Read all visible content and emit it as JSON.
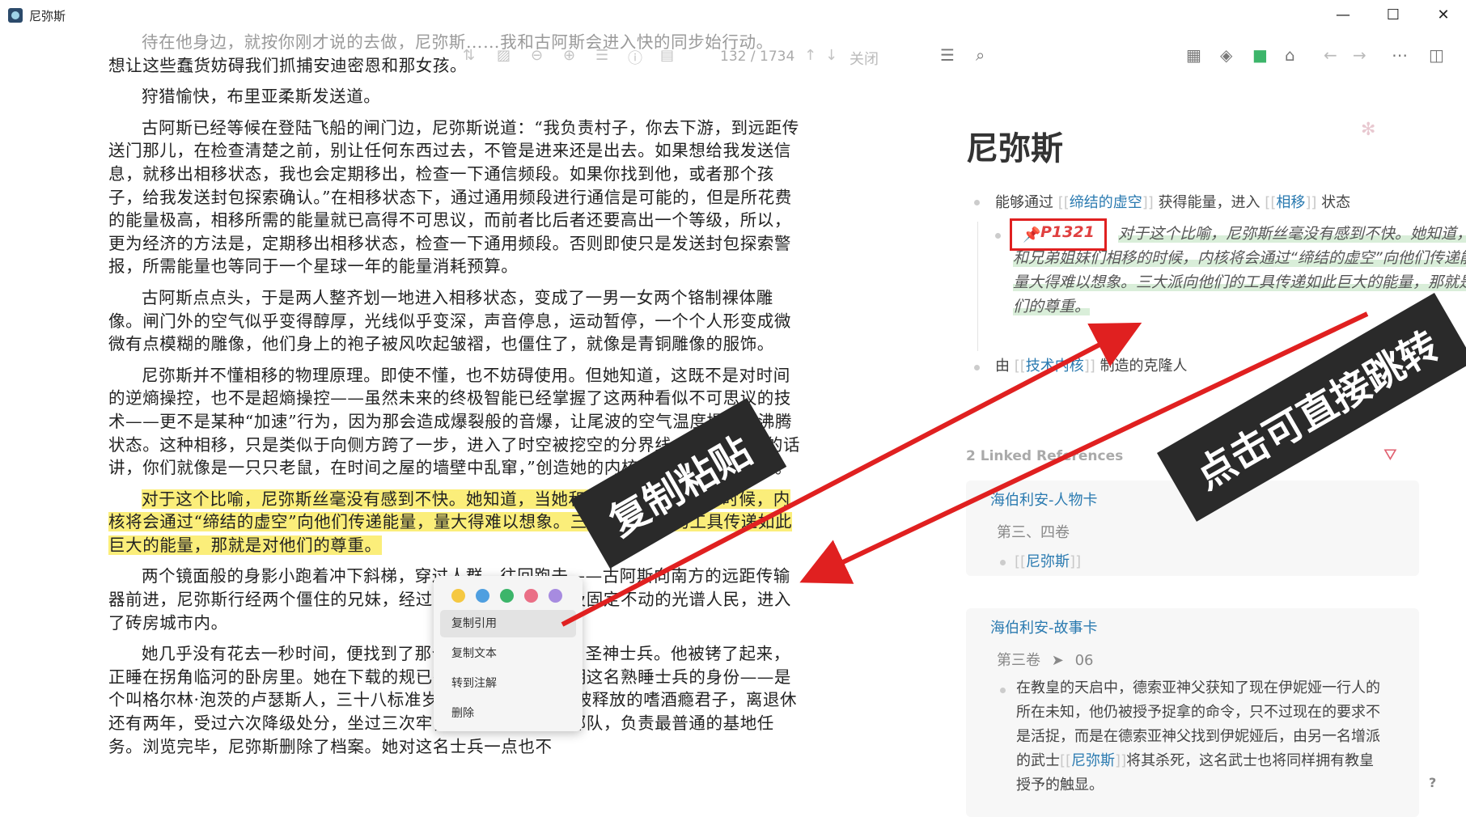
{
  "window": {
    "title": "尼弥斯",
    "min_label": "—",
    "max_label": "☐",
    "close_label": "✕"
  },
  "reader": {
    "toolbar": {
      "page_current": "132",
      "page_total": "1734",
      "close": "关闭"
    },
    "paragraphs": [
      "待在他身边，就按你刚才说的去做，尼弥斯……我和古阿斯会进入快的同步始行动。",
      "想让这些蠢货妨碍我们抓捕安迪密恩和那女孩。",
      "狩猎愉快，布里亚柔斯发送道。",
      "古阿斯已经等候在登陆飞船的闸门边，尼弥斯说道：“我负责村子，你去下游，到远距传送门那儿，在检查清楚之前，别让任何东西过去，不管是进来还是出去。如果想给我发送信息，就移出相移状态，我也会定期移出，检查一下通信频段。如果你找到他，或者那个孩子，给我发送封包探索确认。”在相移状态下，通过通用频段进行通信是可能的，但是所花费的能量极高，相移所需的能量就已高得不可思议，而前者比后者还要高出一个等级，所以，更为经济的方法是，定期移出相移状态，检查一下通用频段。否则即使只是发送封包探索警报，所需能量也等同于一个星球一年的能量消耗预算。",
      "古阿斯点点头，于是两人整齐划一地进入相移状态，变成了一男一女两个铬制裸体雕像。闸门外的空气似乎变得醇厚，光线似乎变深，声音停息，运动暂停，一个个人形变成微微有点模糊的雕像，他们身上的袍子被风吹起皱褶，也僵住了，就像是青铜雕像的服饰。",
      "尼弥斯并不懂相移的物理原理。即使不懂，也不妨碍使用。但她知道，这既不是对时间的逆熵操控，也不是超熵操控——虽然未来的终极智能已经掌握了这两种看似不可思议的技术——更不是某种“加速”行为，因为那会造成爆裂般的音爆，让尾波的空气温度提升至沸腾状态。这种相移，只是类似于向侧方跨了一步，进入了时空被挖空的分界线。“用句好听的话讲，你们就像是一只只老鼠，在时间之屋的墙壁中乱窜，”创造她的内核实体曾经这么说道。",
      "对于这个比喻，尼弥斯丝毫没有感到不快。她知道，当她和兄弟姐妹们相移的时候，内核将会通过“缔结的虚空”向他们传递能量，量大得难以想象。三大派向他们的工具传递如此巨大的能量，那就是对他们的尊重。",
      "两个镜面般的身影小跑着冲下斜梯，穿过人群，往回跑去——古阿斯向南方的远距传输器前进，尼弥斯行经两个僵住的兄妹，经过两个僵住的雕像以及固定不动的光谱人民，进入了砖房城市内。",
      "她几乎没有花去一秒时间，便找到了那个地方，找到了那名圣神士兵。他被铐了起来，正睡在拐角临河的卧房里。她在下载的规已有档案中搜寻，查明这名熟睡士兵的身份——是个叫格尔林·泡茨的卢瑟斯人，三十八标准岁，一个懒家伙，刚被释放的嗜酒瘾君子，离退休还有两年，受过六次降级处分，坐过三次牢，最后分配到守备部队，负责最普通的基地任务。浏览完毕，尼弥斯删除了档案。她对这名士兵一点也不"
    ]
  },
  "context_menu": {
    "colors": [
      "#f5c842",
      "#4f9fe0",
      "#3cb56a",
      "#ea6f86",
      "#a78be0"
    ],
    "items": [
      "复制引用",
      "复制文本",
      "转到注解",
      "删除"
    ]
  },
  "right_pane": {
    "page_title": "尼弥斯",
    "block1": {
      "prefix": "能够通过",
      "link1": "缔结的虚空",
      "middle": "获得能量，进入",
      "link2": "相移",
      "suffix": "状态"
    },
    "quote": {
      "ref": "P1321",
      "text": "对于这个比喻，尼弥斯丝毫没有感到不快。她知道，当她和兄弟姐妹们相移的时候，内核将会通过“缔结的虚空”向他们传递能量，量大得难以想象。三大派向他们的工具传递如此巨大的能量，那就是对他们的尊重。"
    },
    "block2": {
      "prefix": "由",
      "link": "技术内核",
      "suffix": "制造的克隆人"
    },
    "linked_refs_label": "2 Linked References",
    "cards": [
      {
        "title": "海伯利安-人物卡",
        "sub": "第三、四卷",
        "body_link": "尼弥斯"
      },
      {
        "title": "海伯利安-故事卡",
        "sub_a": "第三卷",
        "sub_arrow": "➤",
        "sub_b": "06",
        "body_pre": "在教皇的天启中，德索亚神父获知了现在伊妮娅一行人的所在未知，他仍被授予捉拿的命令，只不过现在的要求不是活捉，而是在德索亚神父找到伊妮娅后，由另一名增派的武士",
        "body_link": "尼弥斯",
        "body_post": "将其杀死，这名武士也将同样拥有教皇授予的触显。"
      }
    ],
    "help": "?"
  },
  "annotations": {
    "banner_left": "复制粘贴",
    "banner_right": "点击可直接跳转",
    "arrow_color": "#e02020"
  }
}
